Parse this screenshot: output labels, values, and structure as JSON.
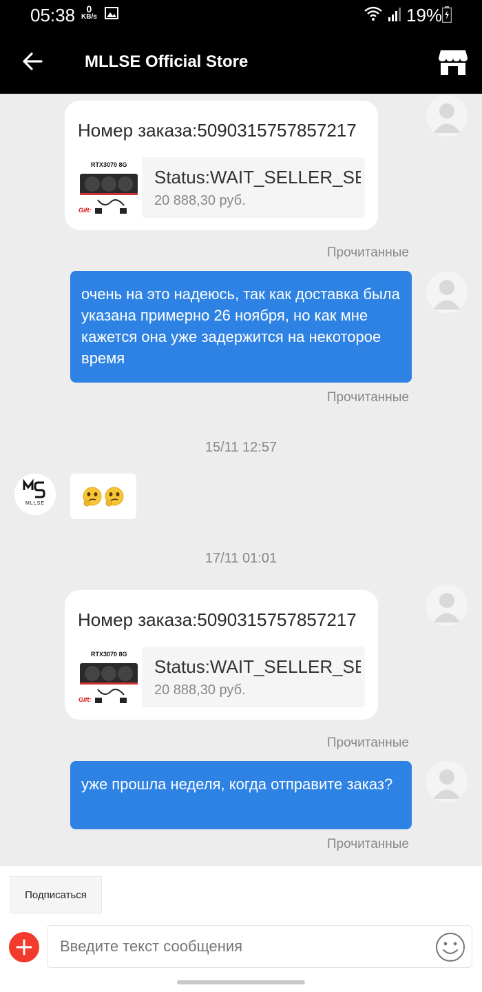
{
  "status_bar": {
    "time": "05:38",
    "net_speed_value": "0",
    "net_speed_unit": "KB/s",
    "battery": "19%"
  },
  "header": {
    "title": "MLLSE Official Store"
  },
  "messages": [
    {
      "type": "order_card",
      "title": "Номер заказа:5090315757857217",
      "product_status": "Status:WAIT_SELLER_SE...",
      "price": "20 888,30 руб.",
      "read_label": "Прочитанные",
      "thumb_label": "RTX3070 8G",
      "thumb_gift": "Gift:"
    },
    {
      "type": "outgoing_text",
      "text": "очень на это надеюсь, так как доставка была указана примерно 26 ноября, но как мне кажется она уже задержится на некоторое время",
      "read_label": "Прочитанные"
    },
    {
      "type": "timestamp",
      "text": "15/11 12:57"
    },
    {
      "type": "incoming_emoji",
      "emoji": "thinking-face-x2"
    },
    {
      "type": "timestamp",
      "text": "17/11 01:01"
    },
    {
      "type": "order_card",
      "title": "Номер заказа:5090315757857217",
      "product_status": "Status:WAIT_SELLER_SE...",
      "price": "20 888,30 руб.",
      "read_label": "Прочитанные",
      "thumb_label": "RTX3070 8G",
      "thumb_gift": "Gift:"
    },
    {
      "type": "outgoing_text",
      "text": "уже прошла неделя, когда отправите заказ?",
      "read_label": "Прочитанные"
    }
  ],
  "seller": {
    "logo_text": "MLLSE"
  },
  "bottom": {
    "subscribe_label": "Подписаться",
    "input_placeholder": "Введите текст сообщения"
  },
  "colors": {
    "accent_blue": "#2d82e4",
    "plus_red": "#f23b2c",
    "header_bg": "#000000",
    "chat_bg": "#ededed"
  }
}
